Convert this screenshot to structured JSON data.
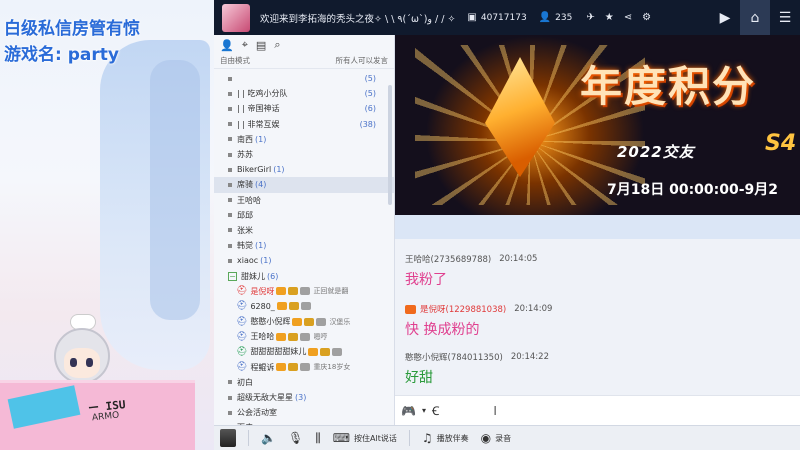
{
  "overlay": {
    "line1": "白级私信房管有惊",
    "line2": "游戏名: party",
    "sign_text": "ー ISU",
    "sign_text2": "ARMO"
  },
  "titlebar": {
    "room_title": "欢迎来到李拓海的秃头之夜✧ \\ \\ ٩(ˊωˋ)و / / ✧",
    "viewers": "40717173",
    "fans": "235"
  },
  "sidebar": {
    "mode": "自由模式",
    "permission": "所有人可以发言",
    "items": [
      {
        "label": "",
        "rightcount": "(5)",
        "type": "channel"
      },
      {
        "label": "| |  吃鸡小分队",
        "rightcount": "(5)",
        "type": "channel"
      },
      {
        "label": "| |  帝国神话",
        "rightcount": "(6)",
        "type": "channel"
      },
      {
        "label": "| |  非常互娱",
        "rightcount": "(38)",
        "type": "channel"
      },
      {
        "label": "南西",
        "count": "(1)",
        "type": "channel"
      },
      {
        "label": "苏苏",
        "count": "",
        "type": "channel"
      },
      {
        "label": "BikerGirl",
        "count": "(1)",
        "type": "channel"
      },
      {
        "label": "席骑",
        "count": "(4)",
        "type": "channel",
        "selected": true
      },
      {
        "label": "王哈哈",
        "count": "",
        "type": "channel"
      },
      {
        "label": "邱邱",
        "count": "",
        "type": "channel"
      },
      {
        "label": "张米",
        "count": "",
        "type": "channel"
      },
      {
        "label": "韩觉",
        "count": "(1)",
        "type": "channel"
      },
      {
        "label": "xiaoc",
        "count": "(1)",
        "type": "channel"
      },
      {
        "label": "甜妹儿",
        "count": "(6)",
        "type": "expanded"
      },
      {
        "label": "是倪呀",
        "extra": "正回就是翻",
        "type": "user",
        "color": "#e03a3a"
      },
      {
        "label": "6280_",
        "type": "user",
        "color": "#4a72c8"
      },
      {
        "label": "憨憨小倪辉",
        "extra": "汉堡乐",
        "type": "user",
        "color": "#4a72c8"
      },
      {
        "label": "王哈哈",
        "extra": "嗯哼",
        "type": "user",
        "color": "#4a72c8"
      },
      {
        "label": "甜甜甜甜甜妹儿",
        "type": "user",
        "color": "#2aa05a"
      },
      {
        "label": "程鲲诉",
        "extra": "重庆18岁女",
        "type": "user",
        "color": "#4a72c8"
      },
      {
        "label": "初白",
        "count": "",
        "type": "channel"
      },
      {
        "label": "超级无敌大星星",
        "count": "(3)",
        "type": "channel"
      },
      {
        "label": "公会活动室",
        "count": "",
        "type": "channel"
      },
      {
        "label": "面皮",
        "count": "",
        "type": "channel"
      }
    ]
  },
  "banner": {
    "headline": "年度积分",
    "sub": "2022交友",
    "season": "S4",
    "dates": "7月18日 00:00:00-9月2"
  },
  "chat": {
    "messages": [
      {
        "name": "王哈哈(2735689788)",
        "time": "20:14:05",
        "text": "我粉了",
        "color": "#e0408f",
        "vip": false
      },
      {
        "name": "是倪呀(1229881038)",
        "time": "20:14:09",
        "text": "快 换成粉的",
        "color": "#e0408f",
        "vip": true
      },
      {
        "name": "憨憨小倪辉(784011350)",
        "time": "20:14:22",
        "text": "好甜",
        "color": "#2a9a3a",
        "vip": false
      }
    ]
  },
  "bottombar": {
    "ptt": "按住Alt说话",
    "music": "播放伴奏",
    "record": "录音"
  }
}
